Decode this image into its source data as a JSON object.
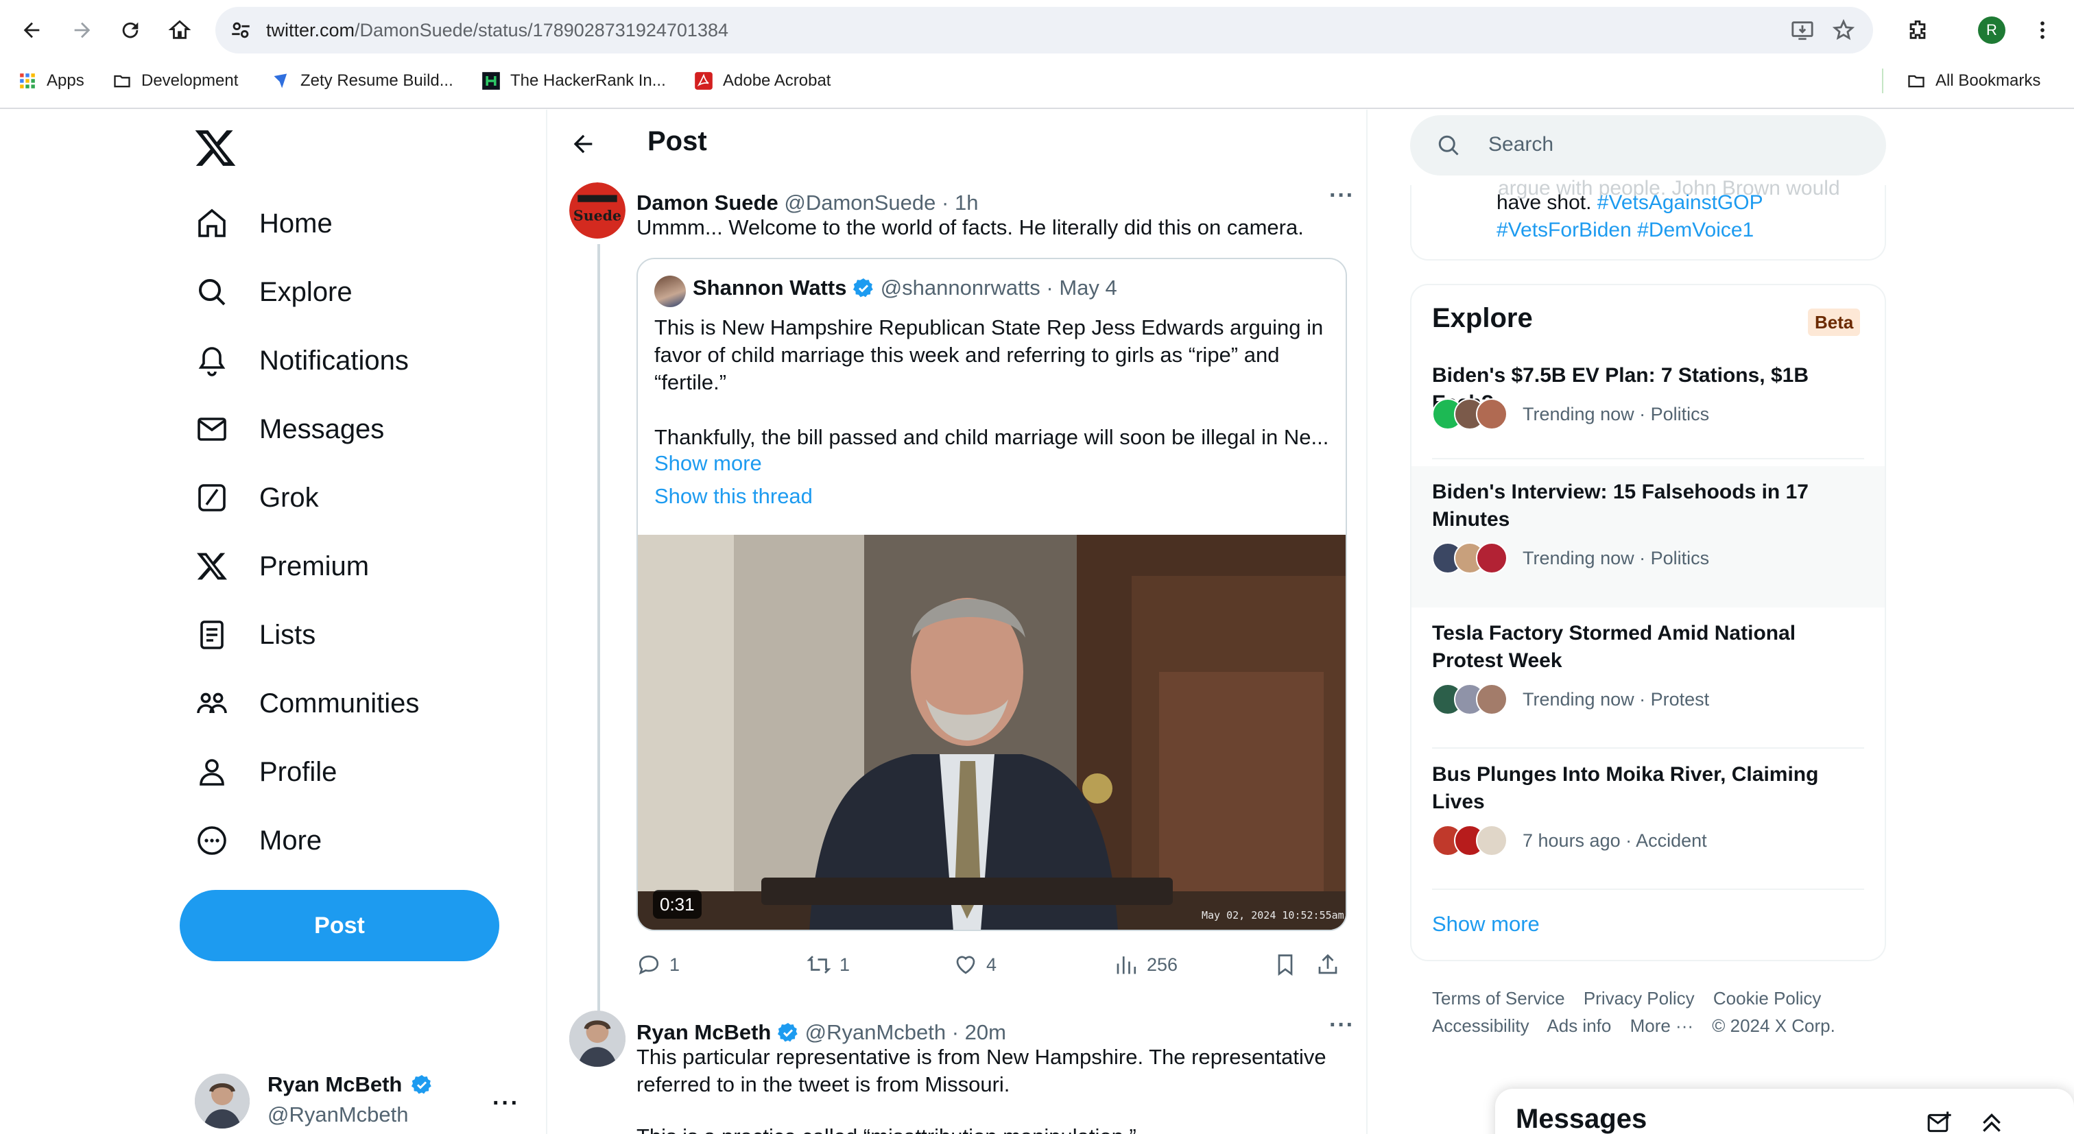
{
  "browser": {
    "url_domain": "twitter.com",
    "url_path": "/DamonSuede/status/1789028731924701384",
    "bookmarks": [
      "Apps",
      "Development",
      "Zety Resume Build...",
      "The HackerRank In...",
      "Adobe Acrobat"
    ],
    "all_bookmarks": "All Bookmarks",
    "profile_initial": "R"
  },
  "nav": {
    "items": [
      {
        "label": "Home",
        "icon": "home-icon"
      },
      {
        "label": "Explore",
        "icon": "search-icon"
      },
      {
        "label": "Notifications",
        "icon": "bell-icon"
      },
      {
        "label": "Messages",
        "icon": "envelope-icon"
      },
      {
        "label": "Grok",
        "icon": "grok-icon"
      },
      {
        "label": "Premium",
        "icon": "x-icon"
      },
      {
        "label": "Lists",
        "icon": "list-icon"
      },
      {
        "label": "Communities",
        "icon": "people-icon"
      },
      {
        "label": "Profile",
        "icon": "person-icon"
      },
      {
        "label": "More",
        "icon": "more-circle-icon"
      }
    ],
    "post_button": "Post",
    "account": {
      "name": "Ryan McBeth",
      "handle": "@RyanMcbeth"
    }
  },
  "main": {
    "header_title": "Post",
    "tweet": {
      "name": "Damon Suede",
      "handle": "@DamonSuede",
      "time": "· 1h",
      "text": "Ummm... Welcome to the world of facts. He literally did this on camera.",
      "avatar_text": "Suede",
      "quote": {
        "name": "Shannon Watts",
        "handle": "@shannonrwatts",
        "time": "· May 4",
        "text": "This is New Hampshire Republican State Rep Jess Edwards arguing in favor of child marriage this week and referring to girls as “ripe” and “fertile.”",
        "text2": "Thankfully, the bill passed and child marriage will soon be illegal in Ne...",
        "show_more": "Show more",
        "show_thread": "Show this thread",
        "video_duration": "0:31",
        "video_stamp": "May 02, 2024 10:52:55am"
      },
      "stats": {
        "replies": "1",
        "reposts": "1",
        "likes": "4",
        "views": "256"
      }
    },
    "reply": {
      "name": "Ryan McBeth",
      "handle": "@RyanMcbeth",
      "time": "· 20m",
      "text": "This particular representative is from New Hampshire. The representative referred to in the tweet is from Missouri.",
      "text2": "This is a practice called “misattribution manipulation.”"
    }
  },
  "sidebar": {
    "search_placeholder": "Search",
    "prev_card": {
      "faded": "argue with people. John Brown would",
      "line1": "have shot.",
      "tags": [
        "#VetsAgainstGOP",
        "#VetsForBiden",
        "#DemVoice1"
      ]
    },
    "explore": {
      "title": "Explore",
      "badge": "Beta",
      "trends": [
        {
          "title": "Biden's $7.5B EV Plan: 7 Stations, $1B Each?",
          "meta": "Trending now · Politics"
        },
        {
          "title": "Biden's Interview: 15 Falsehoods in 17 Minutes",
          "meta": "Trending now · Politics"
        },
        {
          "title": "Tesla Factory Stormed Amid National Protest Week",
          "meta": "Trending now · Protest"
        },
        {
          "title": "Bus Plunges Into Moika River, Claiming Lives",
          "meta": "7 hours ago · Accident"
        }
      ],
      "show_more": "Show more"
    },
    "footer": {
      "row1": [
        "Terms of Service",
        "Privacy Policy",
        "Cookie Policy"
      ],
      "row2": [
        "Accessibility",
        "Ads info",
        "More ···",
        "© 2024 X Corp."
      ]
    },
    "messages_drawer": "Messages"
  },
  "colors": {
    "accent": "#1d9bf0",
    "text": "#0f1419",
    "muted": "#536471"
  }
}
